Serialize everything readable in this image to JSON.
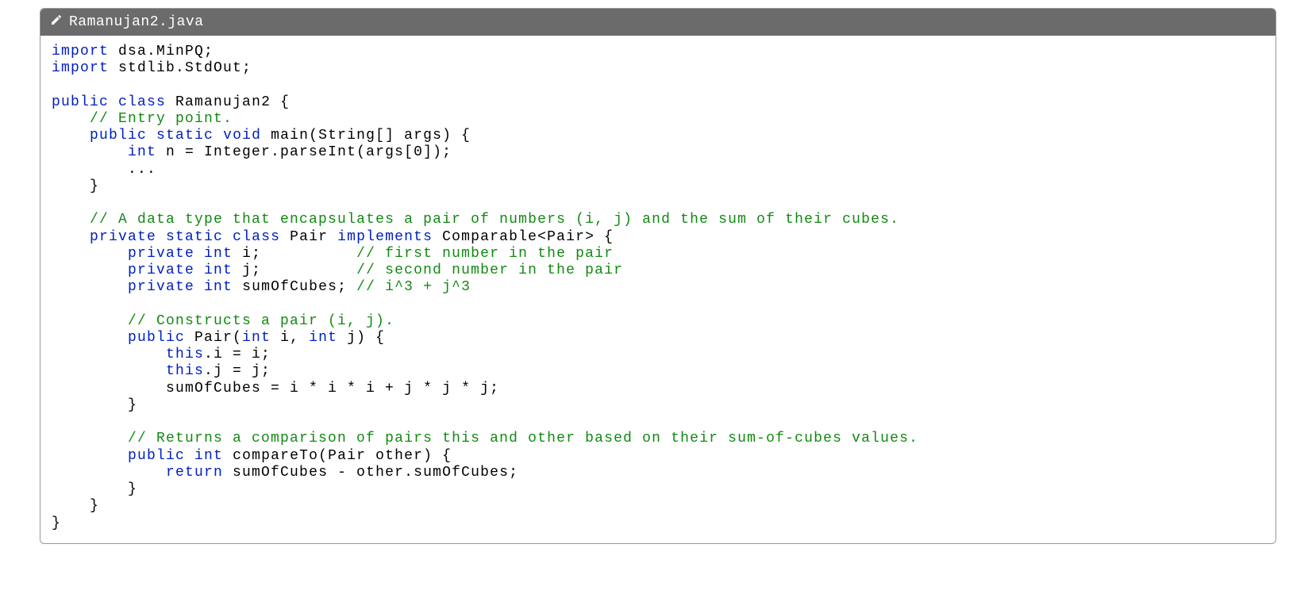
{
  "header": {
    "filename": "Ramanujan2.java"
  },
  "code": {
    "tokens": [
      {
        "t": "import",
        "c": "kw"
      },
      {
        "t": " dsa.MinPQ;\n"
      },
      {
        "t": "import",
        "c": "kw"
      },
      {
        "t": " stdlib.StdOut;\n"
      },
      {
        "t": "\n"
      },
      {
        "t": "public",
        "c": "kw"
      },
      {
        "t": " "
      },
      {
        "t": "class",
        "c": "kw"
      },
      {
        "t": " Ramanujan2 {\n"
      },
      {
        "t": "    "
      },
      {
        "t": "// Entry point.",
        "c": "cm"
      },
      {
        "t": "\n"
      },
      {
        "t": "    "
      },
      {
        "t": "public",
        "c": "kw"
      },
      {
        "t": " "
      },
      {
        "t": "static",
        "c": "kw"
      },
      {
        "t": " "
      },
      {
        "t": "void",
        "c": "kw"
      },
      {
        "t": " main(String[] args) {\n"
      },
      {
        "t": "        "
      },
      {
        "t": "int",
        "c": "kw"
      },
      {
        "t": " n = Integer.parseInt(args[0]);\n"
      },
      {
        "t": "        ...\n"
      },
      {
        "t": "    }\n"
      },
      {
        "t": "\n"
      },
      {
        "t": "    "
      },
      {
        "t": "// A data type that encapsulates a pair of numbers (i, j) and the sum of their cubes.",
        "c": "cm"
      },
      {
        "t": "\n"
      },
      {
        "t": "    "
      },
      {
        "t": "private",
        "c": "kw"
      },
      {
        "t": " "
      },
      {
        "t": "static",
        "c": "kw"
      },
      {
        "t": " "
      },
      {
        "t": "class",
        "c": "kw"
      },
      {
        "t": " Pair "
      },
      {
        "t": "implements",
        "c": "kw"
      },
      {
        "t": " Comparable<Pair> {\n"
      },
      {
        "t": "        "
      },
      {
        "t": "private",
        "c": "kw"
      },
      {
        "t": " "
      },
      {
        "t": "int",
        "c": "kw"
      },
      {
        "t": " i;          "
      },
      {
        "t": "// first number in the pair",
        "c": "cm"
      },
      {
        "t": "\n"
      },
      {
        "t": "        "
      },
      {
        "t": "private",
        "c": "kw"
      },
      {
        "t": " "
      },
      {
        "t": "int",
        "c": "kw"
      },
      {
        "t": " j;          "
      },
      {
        "t": "// second number in the pair",
        "c": "cm"
      },
      {
        "t": "\n"
      },
      {
        "t": "        "
      },
      {
        "t": "private",
        "c": "kw"
      },
      {
        "t": " "
      },
      {
        "t": "int",
        "c": "kw"
      },
      {
        "t": " sumOfCubes; "
      },
      {
        "t": "// i^3 + j^3",
        "c": "cm"
      },
      {
        "t": "\n"
      },
      {
        "t": "\n"
      },
      {
        "t": "        "
      },
      {
        "t": "// Constructs a pair (i, j).",
        "c": "cm"
      },
      {
        "t": "\n"
      },
      {
        "t": "        "
      },
      {
        "t": "public",
        "c": "kw"
      },
      {
        "t": " Pair("
      },
      {
        "t": "int",
        "c": "kw"
      },
      {
        "t": " i, "
      },
      {
        "t": "int",
        "c": "kw"
      },
      {
        "t": " j) {\n"
      },
      {
        "t": "            "
      },
      {
        "t": "this",
        "c": "kw"
      },
      {
        "t": ".i = i;\n"
      },
      {
        "t": "            "
      },
      {
        "t": "this",
        "c": "kw"
      },
      {
        "t": ".j = j;\n"
      },
      {
        "t": "            sumOfCubes = i * i * i + j * j * j;\n"
      },
      {
        "t": "        }\n"
      },
      {
        "t": "\n"
      },
      {
        "t": "        "
      },
      {
        "t": "// Returns a comparison of pairs this and other based on their sum-of-cubes values.",
        "c": "cm"
      },
      {
        "t": "\n"
      },
      {
        "t": "        "
      },
      {
        "t": "public",
        "c": "kw"
      },
      {
        "t": " "
      },
      {
        "t": "int",
        "c": "kw"
      },
      {
        "t": " compareTo(Pair other) {\n"
      },
      {
        "t": "            "
      },
      {
        "t": "return",
        "c": "kw"
      },
      {
        "t": " sumOfCubes - other.sumOfCubes;\n"
      },
      {
        "t": "        }\n"
      },
      {
        "t": "    }\n"
      },
      {
        "t": "}"
      }
    ]
  }
}
